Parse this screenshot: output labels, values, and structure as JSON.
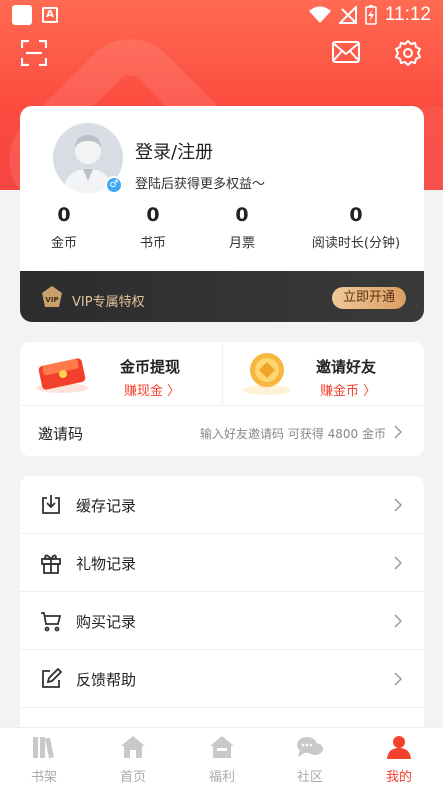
{
  "status_bar": {
    "time": "11:12"
  },
  "profile": {
    "login_title": "登录/注册",
    "login_subtitle": "登陆后获得更多权益～",
    "stats": [
      {
        "value": "0",
        "label": "金币"
      },
      {
        "value": "0",
        "label": "书币"
      },
      {
        "value": "0",
        "label": "月票"
      },
      {
        "value": "0",
        "label": "阅读时长(分钟)"
      }
    ]
  },
  "vip": {
    "badge": "VIP",
    "text": "VIP专属特权",
    "button": "立即开通"
  },
  "rewards": {
    "withdraw": {
      "title": "金币提现",
      "sub": "赚现金 〉"
    },
    "invite": {
      "title": "邀请好友",
      "sub": "赚金币 〉"
    },
    "invite_code": {
      "label": "邀请码",
      "hint": "输入好友邀请码 可获得 4800 金币"
    }
  },
  "menu": [
    {
      "label": "缓存记录",
      "icon": "download-box-icon"
    },
    {
      "label": "礼物记录",
      "icon": "gift-icon"
    },
    {
      "label": "购买记录",
      "icon": "cart-icon"
    },
    {
      "label": "反馈帮助",
      "icon": "edit-icon"
    }
  ],
  "tabs": [
    {
      "label": "书架",
      "icon": "bookshelf-icon",
      "active": false
    },
    {
      "label": "首页",
      "icon": "home-icon",
      "active": false
    },
    {
      "label": "福利",
      "icon": "welfare-icon",
      "active": false
    },
    {
      "label": "社区",
      "icon": "community-icon",
      "active": false
    },
    {
      "label": "我的",
      "icon": "user-icon",
      "active": true
    }
  ],
  "colors": {
    "brand_red": "#f5402c",
    "vip_gold": "#e2c49a"
  }
}
